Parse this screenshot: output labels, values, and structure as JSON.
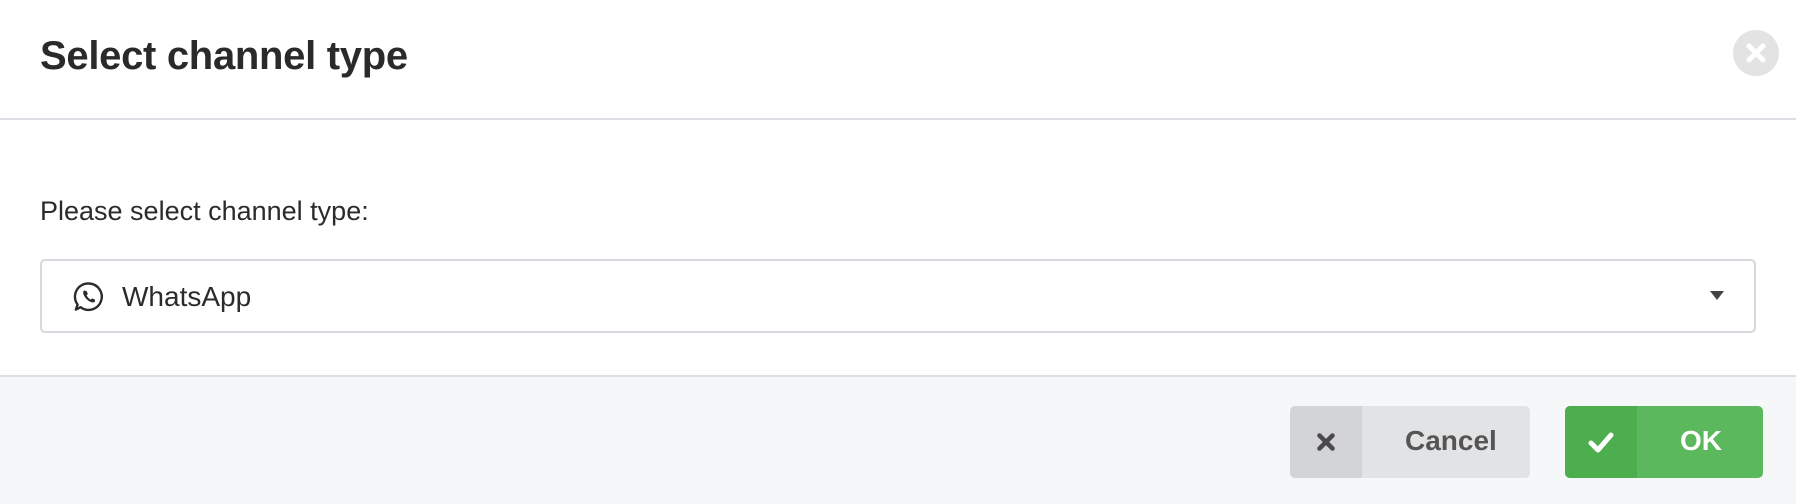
{
  "dialog": {
    "title": "Select channel type",
    "close_icon": "close-circle-icon"
  },
  "form": {
    "label": "Please select channel type:",
    "select": {
      "value": "WhatsApp",
      "icon": "whatsapp-icon",
      "caret_icon": "caret-down-icon"
    }
  },
  "footer": {
    "cancel": {
      "label": "Cancel",
      "icon": "x-icon"
    },
    "ok": {
      "label": "OK",
      "icon": "check-icon"
    }
  },
  "colors": {
    "ok_green": "#5cb85c",
    "ok_green_dark": "#4cae4c",
    "cancel_gray": "#e2e3e5",
    "footer_bg": "#f6f7f9"
  }
}
